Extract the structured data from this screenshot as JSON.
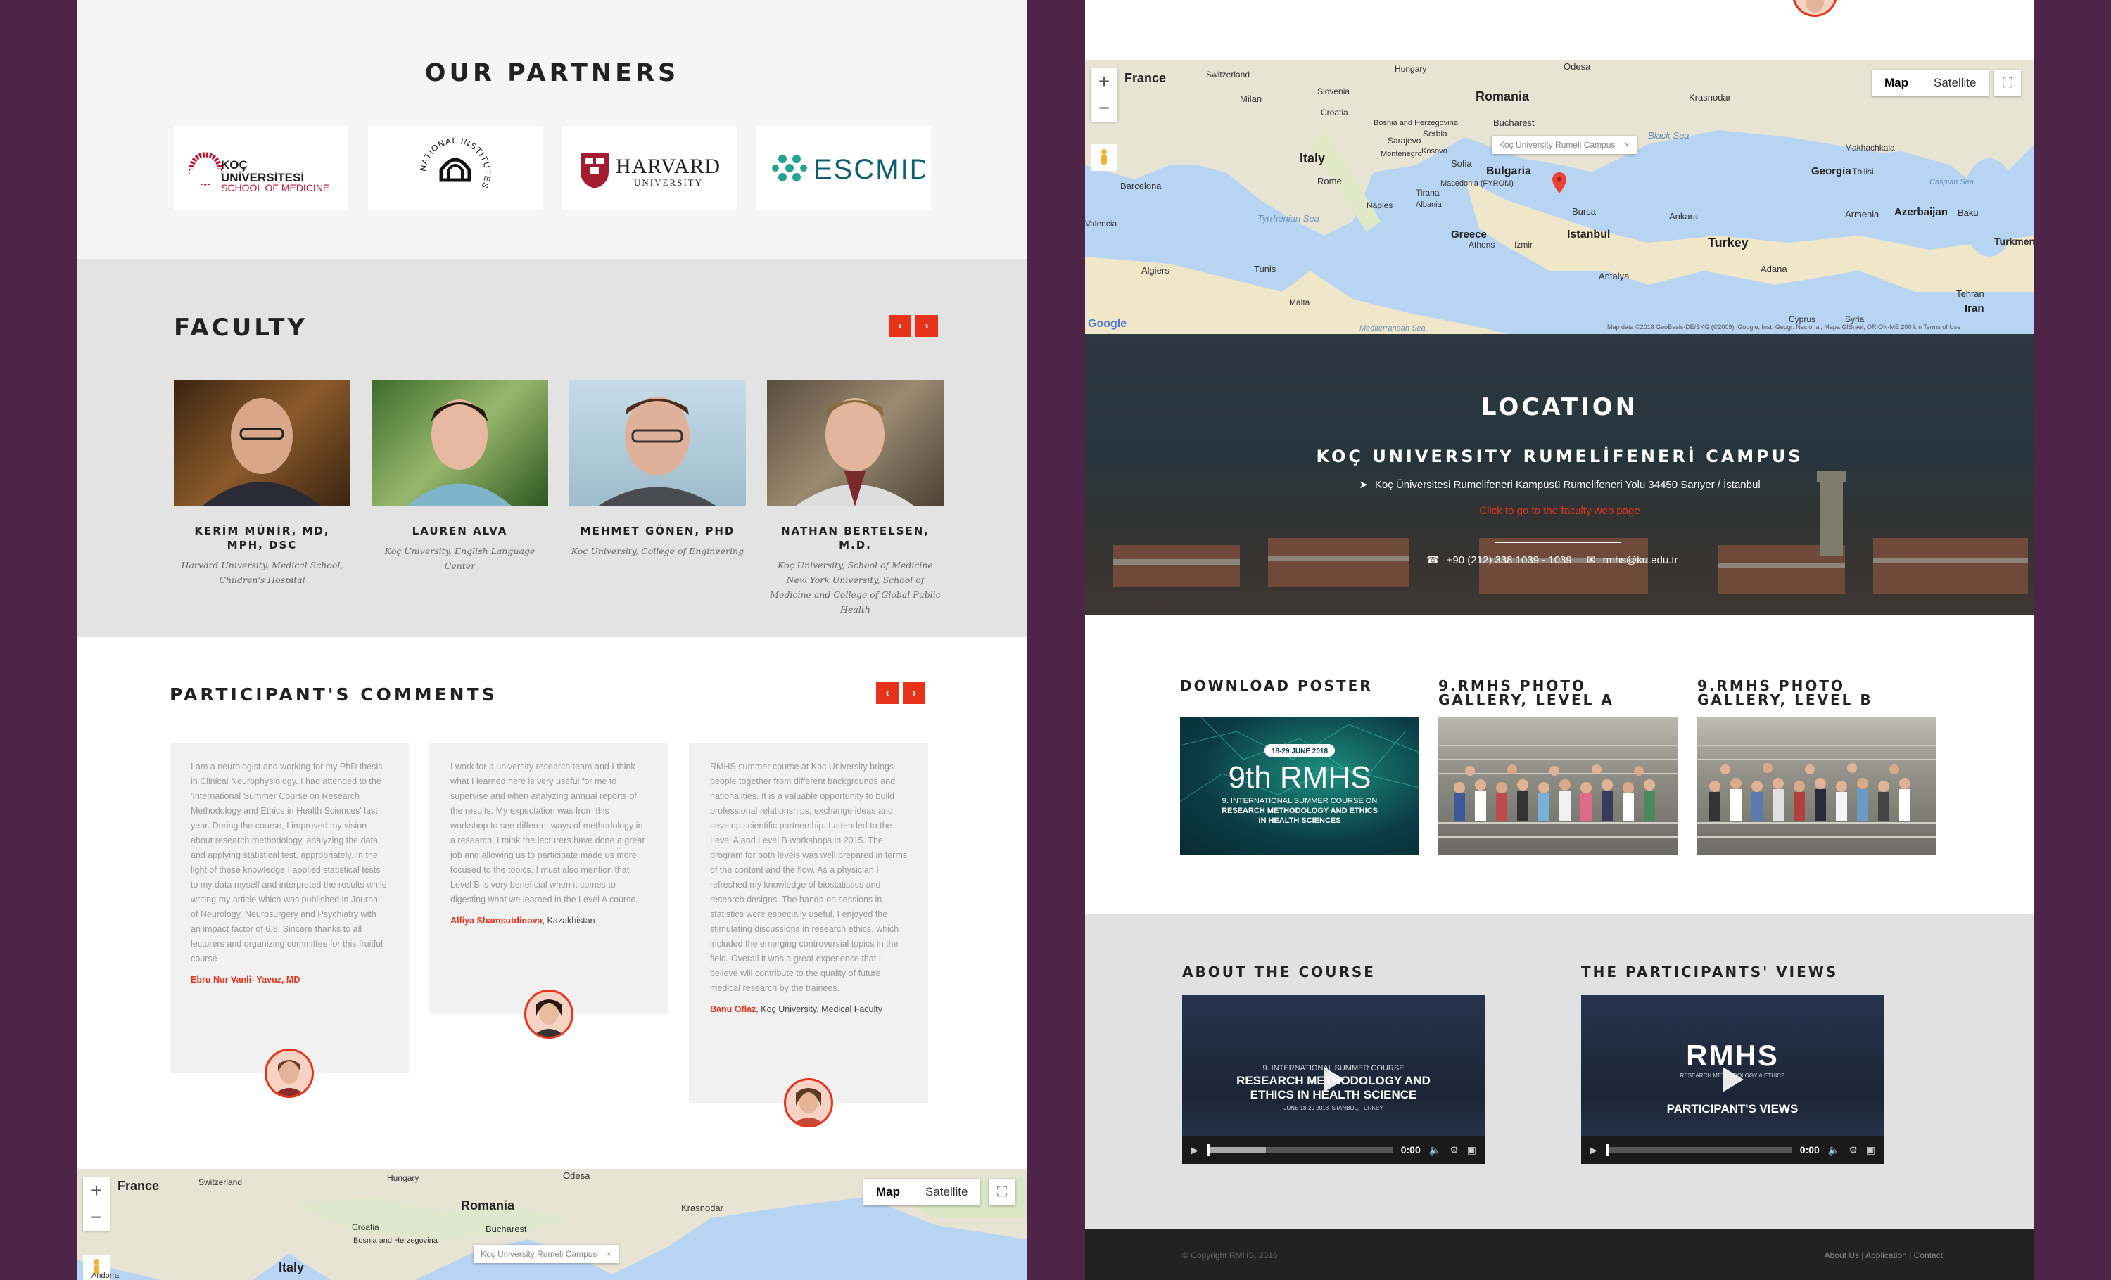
{
  "partners": {
    "title": "OUR PARTNERS",
    "koc": {
      "line1": "KOÇ",
      "line2": "ÜNİVERSİTESİ",
      "line3": "SCHOOL OF MEDICINE"
    },
    "nih": {
      "text": "NATIONAL INSTITUTES OF HEALTH"
    },
    "harvard": {
      "line1": "HARVARD",
      "line2": "UNIVERSITY"
    },
    "escmid": {
      "text": "ESCMID"
    }
  },
  "faculty": {
    "title": "FACULTY",
    "prev": "‹",
    "next": "›",
    "members": [
      {
        "name": "KERİM MÜNİR, MD, MPH, DSC",
        "affiliation": "Harvard University, Medical School, Children's Hospital"
      },
      {
        "name": "LAUREN ALVA",
        "affiliation": "Koç University, English Language Center"
      },
      {
        "name": "MEHMET GÖNEN, PHD",
        "affiliation": "Koç University, College of Engineering"
      },
      {
        "name": "NATHAN BERTELSEN, M.D.",
        "affiliation": "Koç University, School of Medicine New York University, School of Medicine and College of Global Public Health"
      }
    ]
  },
  "comments": {
    "title": "PARTICIPANT'S COMMENTS",
    "prev": "‹",
    "next": "›",
    "items": [
      {
        "text": "I am a neurologist and working for my PhD thesis in Clinical Neurophysiology. I had attended to the 'International Summer Course on Research Methodology and Ethics in Health Sciences' last year. During the course, I improved my vision about research methodology, analyzing the data and applying statistical test, appropriately. In the light of these knowledge I applied statistical tests to my data myself and interpreted the results while writing my article which was published in Journal of Neurology, Neurosurgery and Psychiatry with an impact factor of 6.8. Sincere thanks to all lecturers and organizing committee for this fruitful course",
        "author": "Ebru Nur Vanli- Yavuz, MD",
        "place": ""
      },
      {
        "text": "I work for a university research team and I think what I learned here is very useful for me to supervise and when analyzing annual reports of the results. My expectation was from this workshop to see different ways of  methodology  in a research. I think the lecturers have done a great job and  allowing us to participate made us more focused to the topics. I must also mention that Level B is very beneficial when it comes to digesting what we learned in the Level A course.",
        "author": "Alfiya Shamsutdinova",
        "place": ", Kazakhistan"
      },
      {
        "text": "RMHS summer course at Koc University brings people together from different backgrounds and nationalities. It is a valuable opportunity to build professional relationships, exchange ideas and develop scientific partnership. I attended to the Level A and Level B workshops in 2015. The program for both levels was well prepared in terms of the content and the flow. As a physician I refreshed my knowledge of biostatistics and research designs. The hands-on sessions in statistics were especially useful. I enjoyed the stimulating discussions in research ethics, which included the emerging controversial topics in the field. Overall it was a great experience that I believe will contribute to the quality of future medical research by the trainees.",
        "author": "Banu Oflaz",
        "place": ", Koç University, Medical Faculty"
      }
    ]
  },
  "map": {
    "map_label": "Map",
    "satellite_label": "Satellite",
    "zoom_in": "+",
    "zoom_out": "−",
    "fullscreen": "⛶",
    "infowindow": "Koç University Rumeli Campus",
    "infowindow_close": "×",
    "labels": {
      "france": "France",
      "switzerland": "Switzerland",
      "hungary": "Hungary",
      "romania": "Romania",
      "milan": "Milan",
      "slovenia": "Slovenia",
      "croatia": "Croatia",
      "bosnia": "Bosnia and Herzegovina",
      "serbia": "Serbia",
      "bucharest": "Bucharest",
      "odesa": "Odesa",
      "krasnodar": "Krasnodar",
      "andorra": "Andorra",
      "italy": "Italy",
      "sarajevo": "Sarajevo",
      "montenegro": "Montenegro",
      "kosovo": "Kosovo",
      "sofia": "Sofia",
      "bulgaria": "Bulgaria",
      "black_sea": "Black Sea",
      "georgia": "Georgia",
      "tbilisi": "Tbilisi",
      "armenia": "Armenia",
      "azerbaijan": "Azerbaijan",
      "baku": "Baku",
      "makhachkala": "Makhachkala",
      "caspian": "Caspian Sea",
      "rome": "Rome",
      "barcelona": "Barcelona",
      "naples": "Naples",
      "tirana": "Tirana",
      "albania": "Albania",
      "macedonia": "Macedonia (FYROM)",
      "tyrrhenian": "Tyrrhenian Sea",
      "istanbul": "Istanbul",
      "bursa": "Bursa",
      "ankara": "Ankara",
      "turkey": "Turkey",
      "greece": "Greece",
      "athens": "Athens",
      "izmir": "Izmir",
      "antalya": "Antalya",
      "adana": "Adana",
      "valencia": "Valencia",
      "algiers": "Algiers",
      "tunis": "Tunis",
      "malta": "Malta",
      "mediterranean": "Mediterranean Sea",
      "cyprus": "Cyprus",
      "syria": "Syria",
      "tehran": "Tehran",
      "iran": "Iran",
      "turkmenistan": "Turkmen",
      "google": "Google",
      "attribution": "Map data ©2018 GeoBasis-DE/BKG (©2009), Google, Inst. Geogr. Nacional, Mapa GISrael, ORION-ME   200 km        Terms of Use"
    }
  },
  "location": {
    "title": "LOCATION",
    "campus": "KOÇ UNIVERSITY RUMELİFENERİ CAMPUS",
    "address": "Koç Üniversitesi Rumelifeneri Kampüsü Rumelifeneri Yolu 34450 Sarıyer / İstanbul",
    "link": "Click to go to the faculty web page",
    "phone": "+90 (212) 338 1039 - 1039",
    "email": "rmhs@ku.edu.tr"
  },
  "downloads": {
    "poster_title": "DOWNLOAD POSTER",
    "gallery_a_title": "9.RMHS PHOTO GALLERY, LEVEL A",
    "gallery_b_title": "9.RMHS PHOTO GALLERY, LEVEL B",
    "poster": {
      "date": "18-29 JUNE 2018",
      "big": "9th RMHS",
      "line1": "9. INTERNATIONAL SUMMER COURSE ON",
      "line2": "RESEARCH METHODOLOGY AND ETHICS",
      "line3": "IN HEALTH SCIENCES"
    }
  },
  "videos": {
    "about_title": "ABOUT THE COURSE",
    "views_title": "THE PARTICIPANTS' VIEWS",
    "about_overlay1": "9. INTERNATIONAL SUMMER COURSE",
    "about_overlay2": "RESEARCH METHODOLOGY AND",
    "about_overlay3": "ETHICS IN HEALTH SCIENCE",
    "about_overlay4": "JUNE 18-29 2018 ISTANBUL, TURKEY",
    "views_overlay1": "RMHS",
    "views_overlay2": "RESEARCH METHODOLOGY & ETHICS",
    "views_overlay3": "PARTICIPANT'S VIEWS",
    "time": "0:00"
  },
  "footer": {
    "copyright": "© Copyright RMHS, 2016",
    "about": "About Us",
    "application": "Application",
    "contact": "Contact",
    "sep": "|"
  },
  "colors": {
    "accent": "#e8331b",
    "frame": "#4e2548"
  }
}
